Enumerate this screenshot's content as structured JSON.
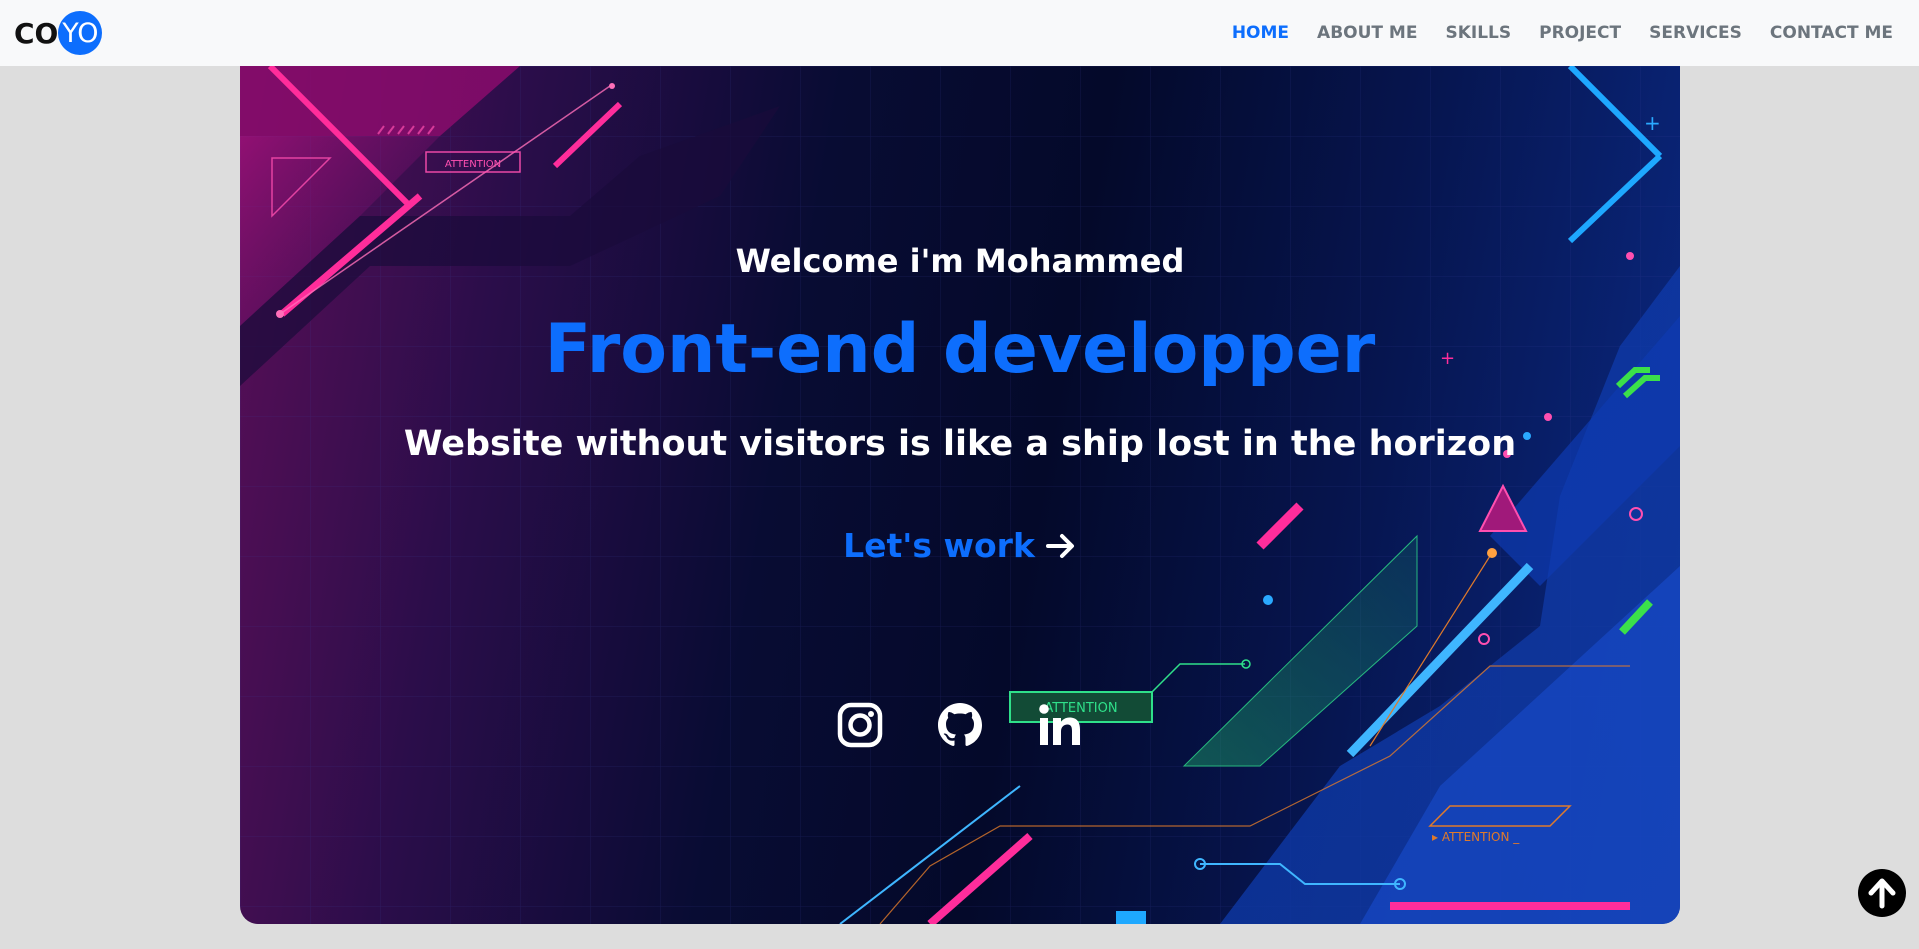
{
  "logo": {
    "part1": "CO",
    "part2": "YO"
  },
  "nav": {
    "items": [
      {
        "label": "HOME",
        "active": true
      },
      {
        "label": "ABOUT ME"
      },
      {
        "label": "SKILLS"
      },
      {
        "label": "PROJECT"
      },
      {
        "label": "SERVICES"
      },
      {
        "label": "CONTACT ME"
      }
    ]
  },
  "hero": {
    "welcome": "Welcome i'm Mohammed",
    "role": "Front-end developper",
    "tagline": "Website without visitors is like a ship lost in the horizon",
    "cta_label": "Let's work",
    "cta_icon": "arrow-right-icon",
    "decor_labels": {
      "attention_1": "ATTENTION",
      "attention_2": "ATTENTION",
      "attention_3": "▸ ATTENTION _"
    }
  },
  "social": [
    {
      "icon": "instagram-icon"
    },
    {
      "icon": "github-icon"
    },
    {
      "icon": "linkedin-icon"
    }
  ],
  "scroll_top": {
    "icon": "arrow-up-icon"
  },
  "colors": {
    "accent": "#0d6efd",
    "nav_text": "#6c757d",
    "page_bg": "#dddddd",
    "navbar_bg": "#f8f9fa"
  }
}
